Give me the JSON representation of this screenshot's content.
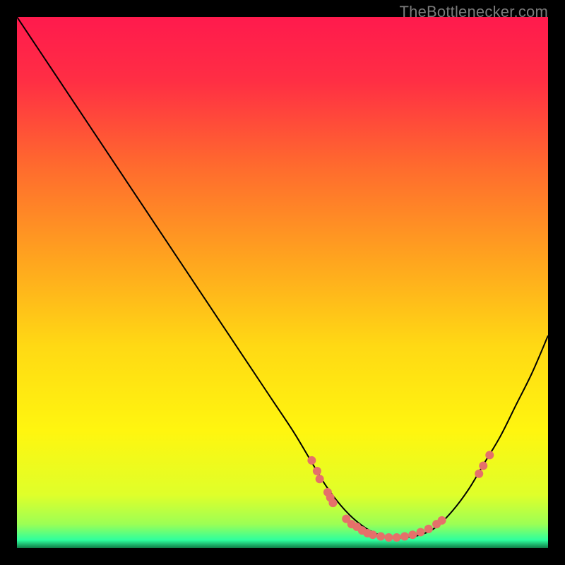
{
  "watermark": {
    "text": "TheBottlenecker.com"
  },
  "chart_data": {
    "type": "line",
    "title": "",
    "xlabel": "",
    "ylabel": "",
    "xlim": [
      0,
      100
    ],
    "ylim": [
      0,
      100
    ],
    "grid": false,
    "legend": false,
    "background_gradient": {
      "stops": [
        {
          "offset": 0.0,
          "color": "#ff1a4d"
        },
        {
          "offset": 0.12,
          "color": "#ff2e44"
        },
        {
          "offset": 0.28,
          "color": "#ff6a2e"
        },
        {
          "offset": 0.45,
          "color": "#ffa21f"
        },
        {
          "offset": 0.62,
          "color": "#ffd914"
        },
        {
          "offset": 0.78,
          "color": "#fff60f"
        },
        {
          "offset": 0.9,
          "color": "#dfff2a"
        },
        {
          "offset": 0.955,
          "color": "#9cff55"
        },
        {
          "offset": 0.985,
          "color": "#2eff9e"
        },
        {
          "offset": 1.0,
          "color": "#0f7d46"
        }
      ]
    },
    "series": [
      {
        "name": "bottleneck-curve",
        "color": "#000000",
        "stroke_width": 2,
        "x": [
          0.0,
          4.0,
          8.0,
          12.0,
          16.0,
          20.0,
          24.0,
          28.0,
          32.0,
          36.0,
          40.0,
          44.0,
          48.0,
          52.0,
          55.0,
          58.0,
          61.0,
          64.0,
          67.0,
          70.0,
          73.0,
          76.0,
          79.0,
          82.0,
          85.0,
          88.0,
          91.0,
          94.0,
          97.0,
          100.0
        ],
        "y": [
          100.0,
          94.0,
          88.0,
          82.0,
          76.0,
          70.0,
          64.0,
          58.0,
          52.0,
          46.0,
          40.0,
          34.0,
          28.0,
          22.0,
          17.0,
          12.0,
          8.0,
          5.0,
          3.0,
          2.0,
          2.0,
          2.5,
          4.0,
          7.0,
          11.0,
          16.0,
          21.0,
          27.0,
          33.0,
          40.0
        ]
      }
    ],
    "markers": {
      "name": "highlight-points",
      "color": "#e5706a",
      "radius": 6,
      "points": [
        {
          "x": 55.5,
          "y": 16.5
        },
        {
          "x": 56.5,
          "y": 14.5
        },
        {
          "x": 57.0,
          "y": 13.0
        },
        {
          "x": 58.5,
          "y": 10.5
        },
        {
          "x": 59.0,
          "y": 9.5
        },
        {
          "x": 59.5,
          "y": 8.5
        },
        {
          "x": 62.0,
          "y": 5.5
        },
        {
          "x": 63.0,
          "y": 4.5
        },
        {
          "x": 64.0,
          "y": 4.0
        },
        {
          "x": 65.0,
          "y": 3.3
        },
        {
          "x": 66.0,
          "y": 2.8
        },
        {
          "x": 67.0,
          "y": 2.5
        },
        {
          "x": 68.5,
          "y": 2.2
        },
        {
          "x": 70.0,
          "y": 2.0
        },
        {
          "x": 71.5,
          "y": 2.0
        },
        {
          "x": 73.0,
          "y": 2.2
        },
        {
          "x": 74.5,
          "y": 2.5
        },
        {
          "x": 76.0,
          "y": 3.0
        },
        {
          "x": 77.5,
          "y": 3.6
        },
        {
          "x": 79.0,
          "y": 4.5
        },
        {
          "x": 80.0,
          "y": 5.2
        },
        {
          "x": 87.0,
          "y": 14.0
        },
        {
          "x": 87.8,
          "y": 15.5
        },
        {
          "x": 89.0,
          "y": 17.5
        }
      ]
    }
  }
}
